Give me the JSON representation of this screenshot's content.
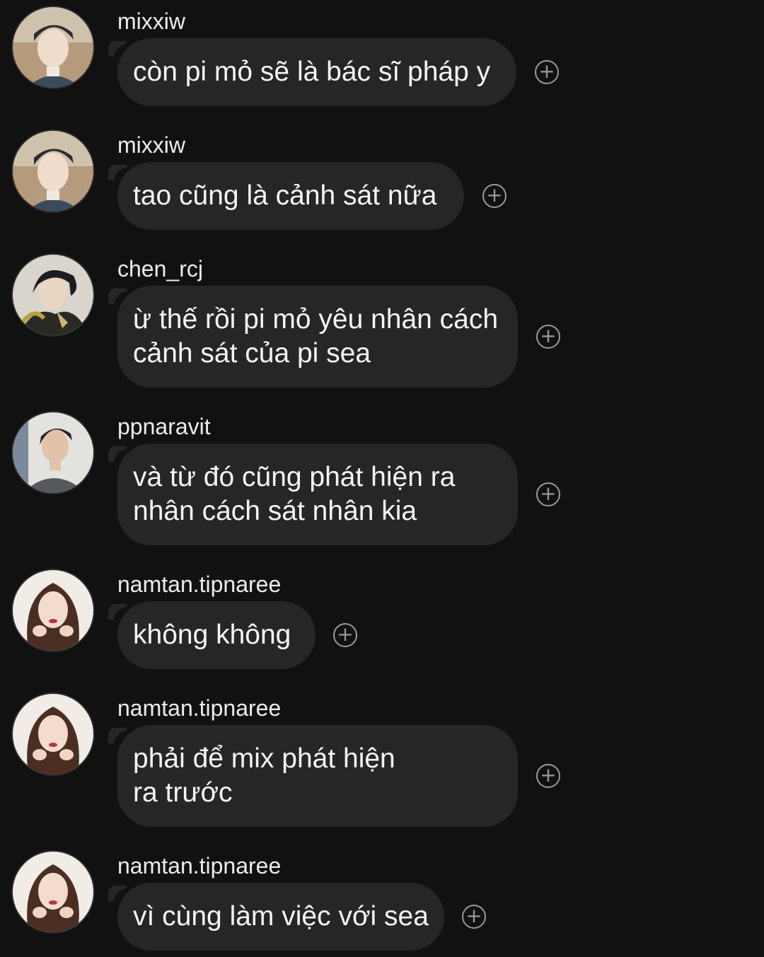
{
  "messages": [
    {
      "username": "mixxiw",
      "text": "còn pi mỏ sẽ là bác sĩ pháp y",
      "avatar": "avatar-mixxiw"
    },
    {
      "username": "mixxiw",
      "text": "tao cũng là cảnh sát nữa",
      "avatar": "avatar-mixxiw"
    },
    {
      "username": "chen_rcj",
      "text": "ừ thế rồi pi mỏ yêu nhân cách cảnh sát của pi sea",
      "avatar": "avatar-chen"
    },
    {
      "username": "ppnaravit",
      "text": "và từ đó cũng phát hiện ra nhân cách sát nhân kia",
      "avatar": "avatar-ppnaravit"
    },
    {
      "username": "namtan.tipnaree",
      "text": "không không",
      "avatar": "avatar-namtan"
    },
    {
      "username": "namtan.tipnaree",
      "text": "phải để mix phát hiện ra trước",
      "avatar": "avatar-namtan"
    },
    {
      "username": "namtan.tipnaree",
      "text": "vì cùng làm việc với sea",
      "avatar": "avatar-namtan"
    }
  ],
  "react_icon": "add-reaction-icon",
  "colors": {
    "background": "#111112",
    "bubble": "#262628",
    "text": "#f4f4f4",
    "icon": "#9a9a9a"
  }
}
